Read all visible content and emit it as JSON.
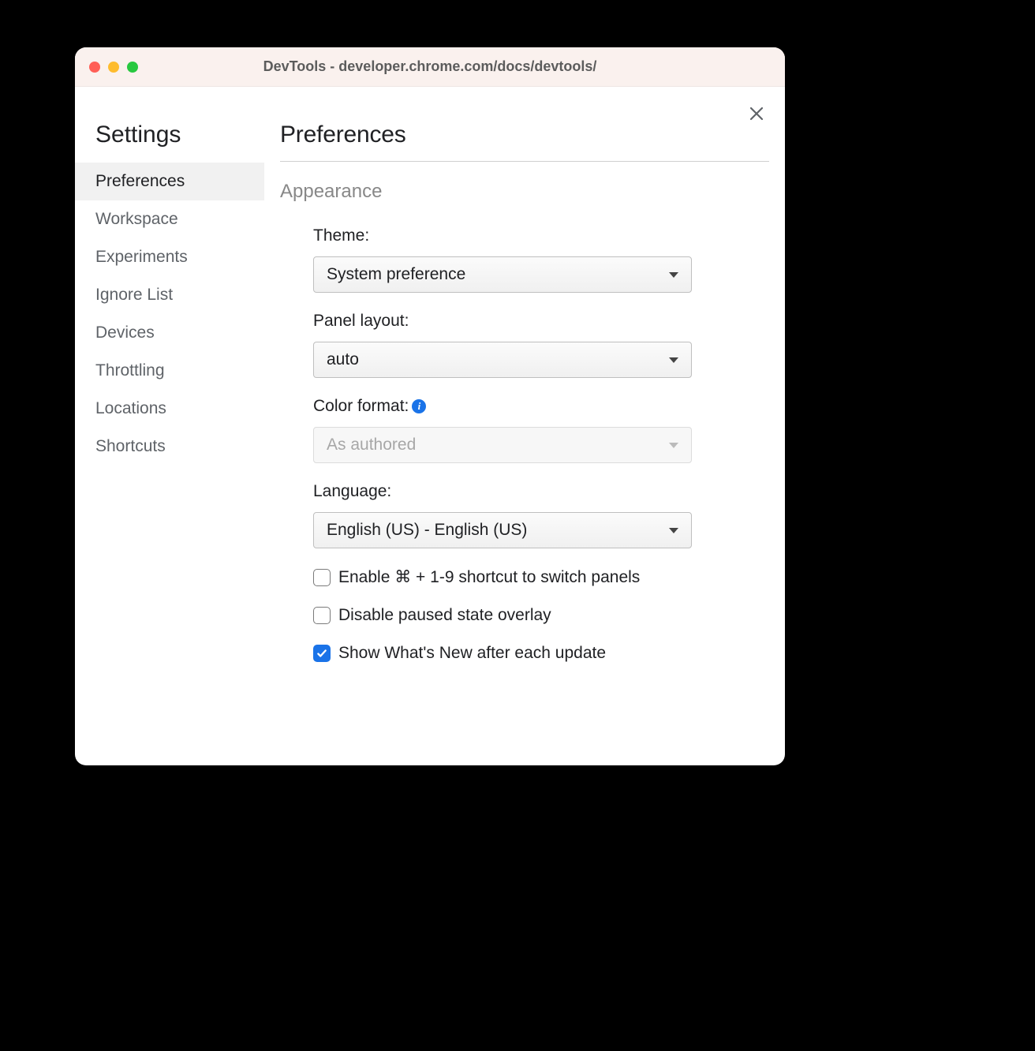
{
  "window": {
    "title": "DevTools - developer.chrome.com/docs/devtools/"
  },
  "sidebar": {
    "heading": "Settings",
    "items": [
      {
        "label": "Preferences",
        "active": true
      },
      {
        "label": "Workspace",
        "active": false
      },
      {
        "label": "Experiments",
        "active": false
      },
      {
        "label": "Ignore List",
        "active": false
      },
      {
        "label": "Devices",
        "active": false
      },
      {
        "label": "Throttling",
        "active": false
      },
      {
        "label": "Locations",
        "active": false
      },
      {
        "label": "Shortcuts",
        "active": false
      }
    ]
  },
  "main": {
    "title": "Preferences",
    "section": "Appearance",
    "fields": {
      "theme": {
        "label": "Theme:",
        "value": "System preference",
        "disabled": false
      },
      "panel_layout": {
        "label": "Panel layout:",
        "value": "auto",
        "disabled": false
      },
      "color_format": {
        "label": "Color format:",
        "value": "As authored",
        "disabled": true,
        "info": true
      },
      "language": {
        "label": "Language:",
        "value": "English (US) - English (US)",
        "disabled": false
      }
    },
    "checkboxes": [
      {
        "label": "Enable ⌘ + 1-9 shortcut to switch panels",
        "checked": false
      },
      {
        "label": "Disable paused state overlay",
        "checked": false
      },
      {
        "label": "Show What's New after each update",
        "checked": true
      }
    ]
  }
}
